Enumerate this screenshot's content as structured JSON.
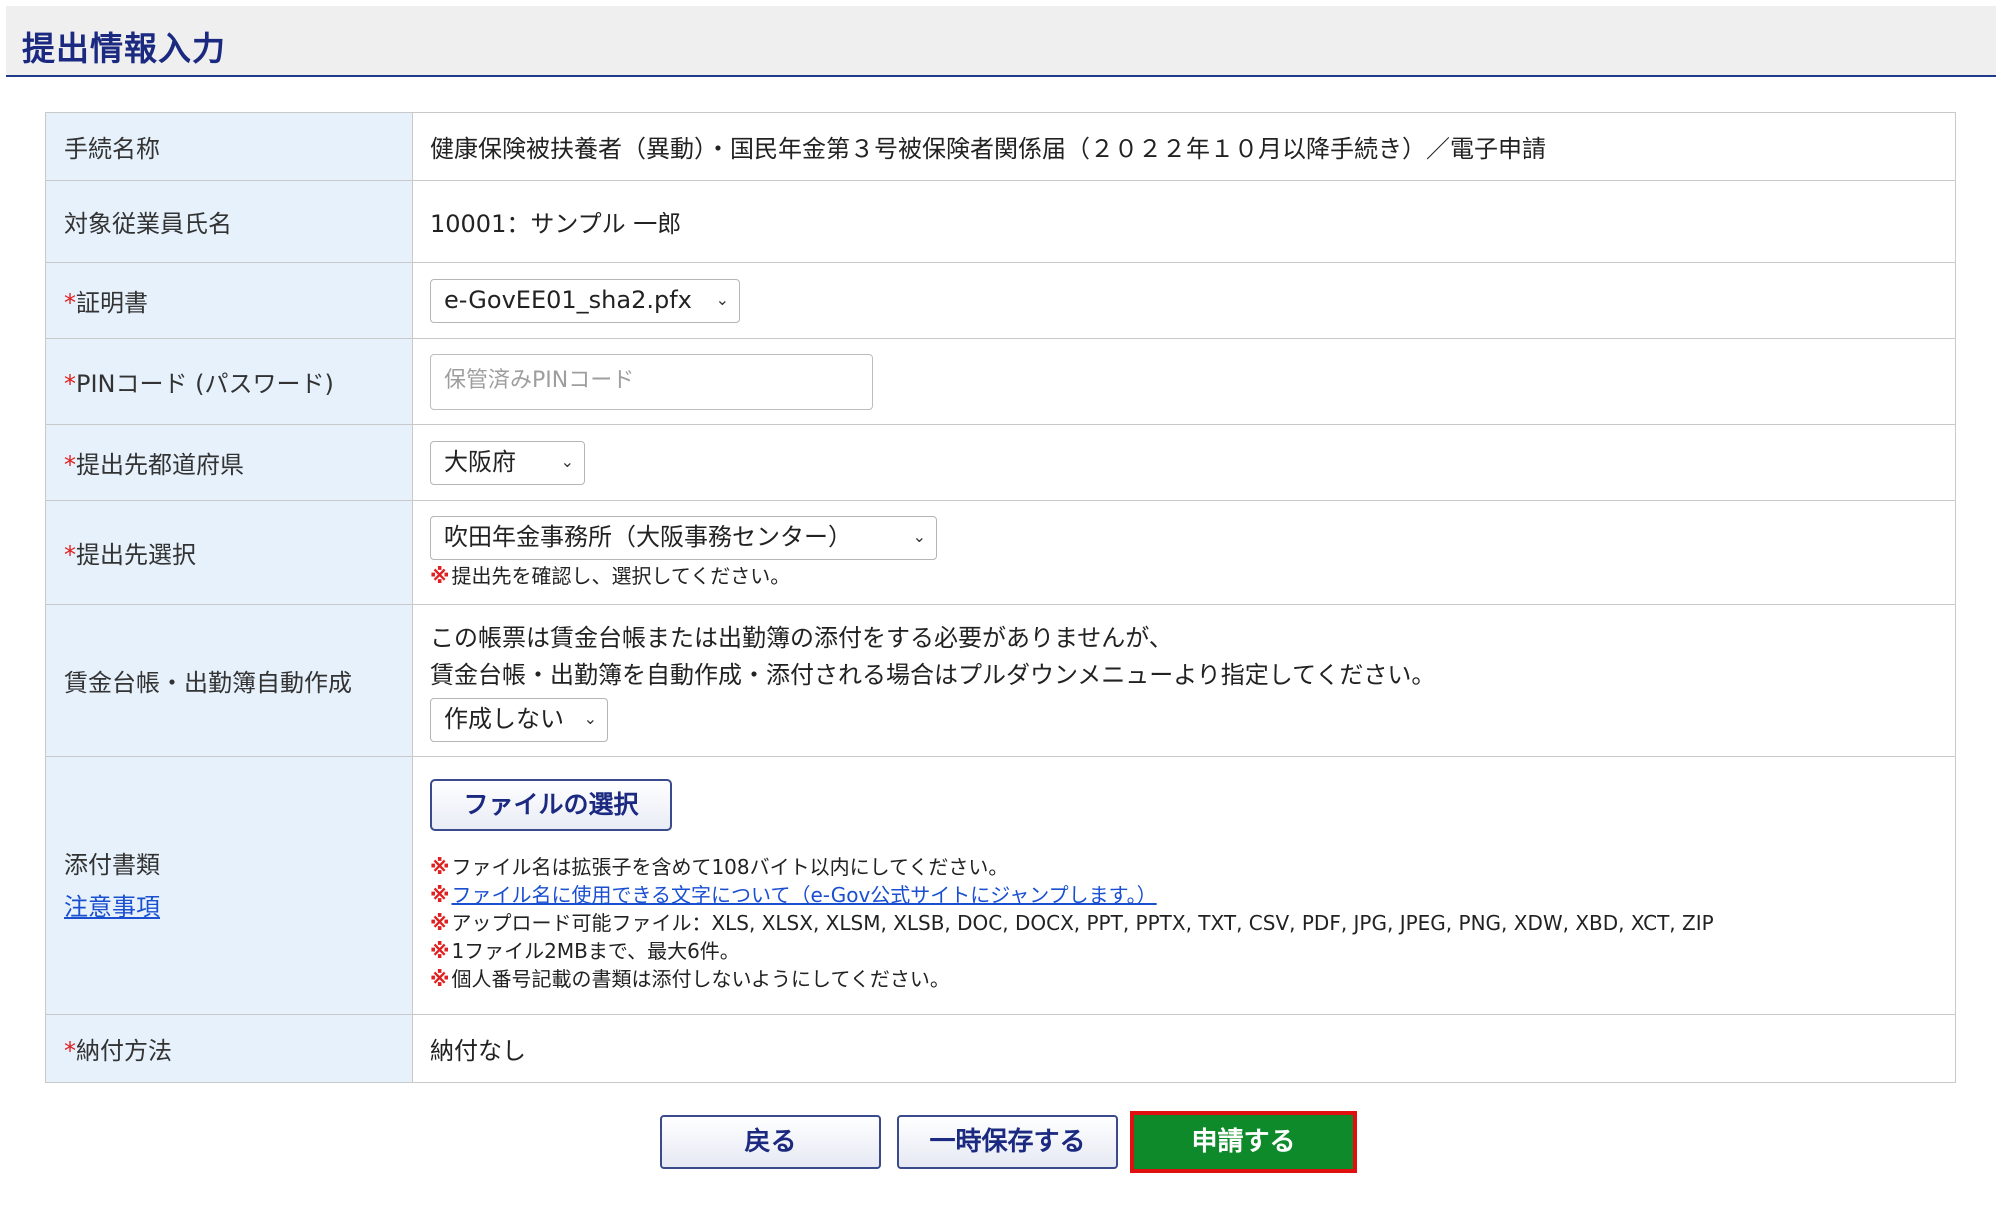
{
  "header": {
    "title": "提出情報入力"
  },
  "form": {
    "procedure": {
      "label": "手続名称",
      "value": "健康保険被扶養者（異動）・国民年金第３号被保険者関係届（２０２２年１０月以降手続き）／電子申請"
    },
    "employee": {
      "label": "対象従業員氏名",
      "value": "10001：サンプル 一郎"
    },
    "certificate": {
      "req": "*",
      "label": "証明書",
      "selected": "e-GovEE01_sha2.pfx"
    },
    "pin": {
      "req": "*",
      "label": "PINコード (パスワード)",
      "placeholder": "保管済みPINコード"
    },
    "prefecture": {
      "req": "*",
      "label": "提出先都道府県",
      "selected": "大阪府"
    },
    "destination": {
      "req": "*",
      "label": "提出先選択",
      "selected": "吹田年金事務所（大阪事務センター）",
      "note_mark": "※",
      "note": "提出先を確認し、選択してください。"
    },
    "wage": {
      "label": "賃金台帳・出勤簿自動作成",
      "text1": "この帳票は賃金台帳または出勤簿の添付をする必要がありませんが、",
      "text2": "賃金台帳・出勤簿を自動作成・添付される場合はプルダウンメニューより指定してください。",
      "selected": "作成しない"
    },
    "attachments": {
      "label": "添付書類",
      "caution_link": "注意事項",
      "file_button": "ファイルの選択",
      "mark": "※",
      "note1": "ファイル名は拡張子を含めて108バイト以内にしてください。",
      "note2_link": "ファイル名に使用できる文字について（e-Gov公式サイトにジャンプします。）",
      "note3": "アップロード可能ファイル：XLS, XLSX, XLSM, XLSB, DOC, DOCX, PPT, PPTX, TXT, CSV, PDF, JPG, JPEG, PNG, XDW, XBD, XCT, ZIP",
      "note4": "1ファイル2MBまで、最大6件。",
      "note5": "個人番号記載の書類は添付しないようにしてください。"
    },
    "payment": {
      "req": "*",
      "label": "納付方法",
      "value": "納付なし"
    }
  },
  "buttons": {
    "back": "戻る",
    "save_draft": "一時保存する",
    "apply": "申請する"
  },
  "colors": {
    "label_bg": "#e6f1fb",
    "title": "#1b2a80",
    "apply_bg": "#0e8a2a",
    "apply_border": "#e01010",
    "required": "#e02020"
  }
}
